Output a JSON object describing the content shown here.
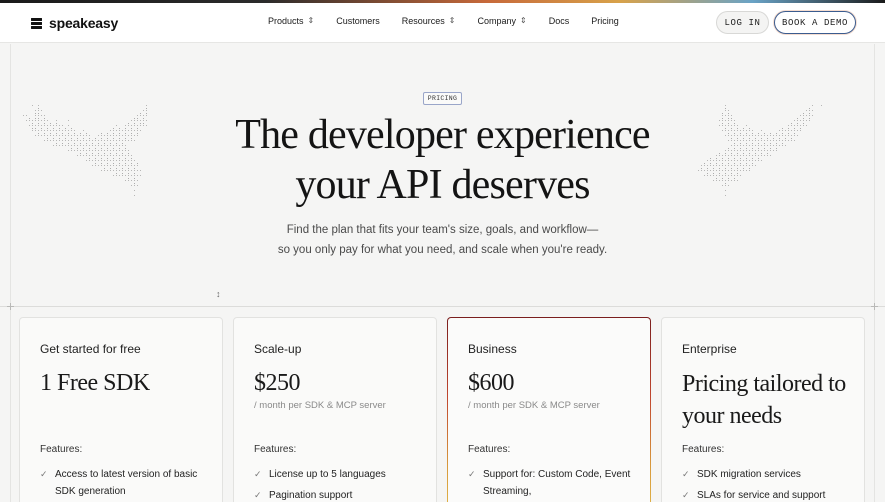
{
  "brand": {
    "name": "speakeasy",
    "logo_icon": "stack-logo-icon"
  },
  "nav": {
    "items": [
      {
        "label": "Products",
        "has_dropdown": true
      },
      {
        "label": "Customers",
        "has_dropdown": false
      },
      {
        "label": "Resources",
        "has_dropdown": true
      },
      {
        "label": "Company",
        "has_dropdown": true
      },
      {
        "label": "Docs",
        "has_dropdown": false
      },
      {
        "label": "Pricing",
        "has_dropdown": false
      }
    ],
    "dropdown_icon": "chevron-updown-icon"
  },
  "actions": {
    "login_label": "LOG IN",
    "demo_label": "BOOK A DEMO"
  },
  "hero": {
    "badge": "PRICING",
    "headline_line1": "The developer experience",
    "headline_line2": "your API deserves",
    "sub_line1": "Find the plan that fits your team's size, goals, and workflow—",
    "sub_line2": "so you only pay for what you need, and scale when you're ready."
  },
  "plans": [
    {
      "name": "Get started for free",
      "price": "1 Free SDK",
      "unit": "",
      "features_label": "Features:",
      "features": [
        "Access to latest version of basic SDK generation"
      ]
    },
    {
      "name": "Scale-up",
      "price": "$250",
      "unit": "/ month per SDK & MCP server",
      "features_label": "Features:",
      "features": [
        "License up to 5 languages",
        "Pagination support"
      ]
    },
    {
      "name": "Business",
      "price": "$600",
      "unit": "/ month per SDK & MCP server",
      "features_label": "Features:",
      "features": [
        "Support for: Custom Code, Event Streaming,"
      ]
    },
    {
      "name": "Enterprise",
      "price": "Pricing tailored to your needs",
      "unit": "",
      "features_label": "Features:",
      "features": [
        "SDK migration services",
        "SLAs for service and support"
      ]
    }
  ],
  "colors": {
    "accent_border": "#3b5c8f",
    "highlight_gradient_top": "#7a1e1e",
    "highlight_gradient_bottom": "#e0b74a"
  }
}
